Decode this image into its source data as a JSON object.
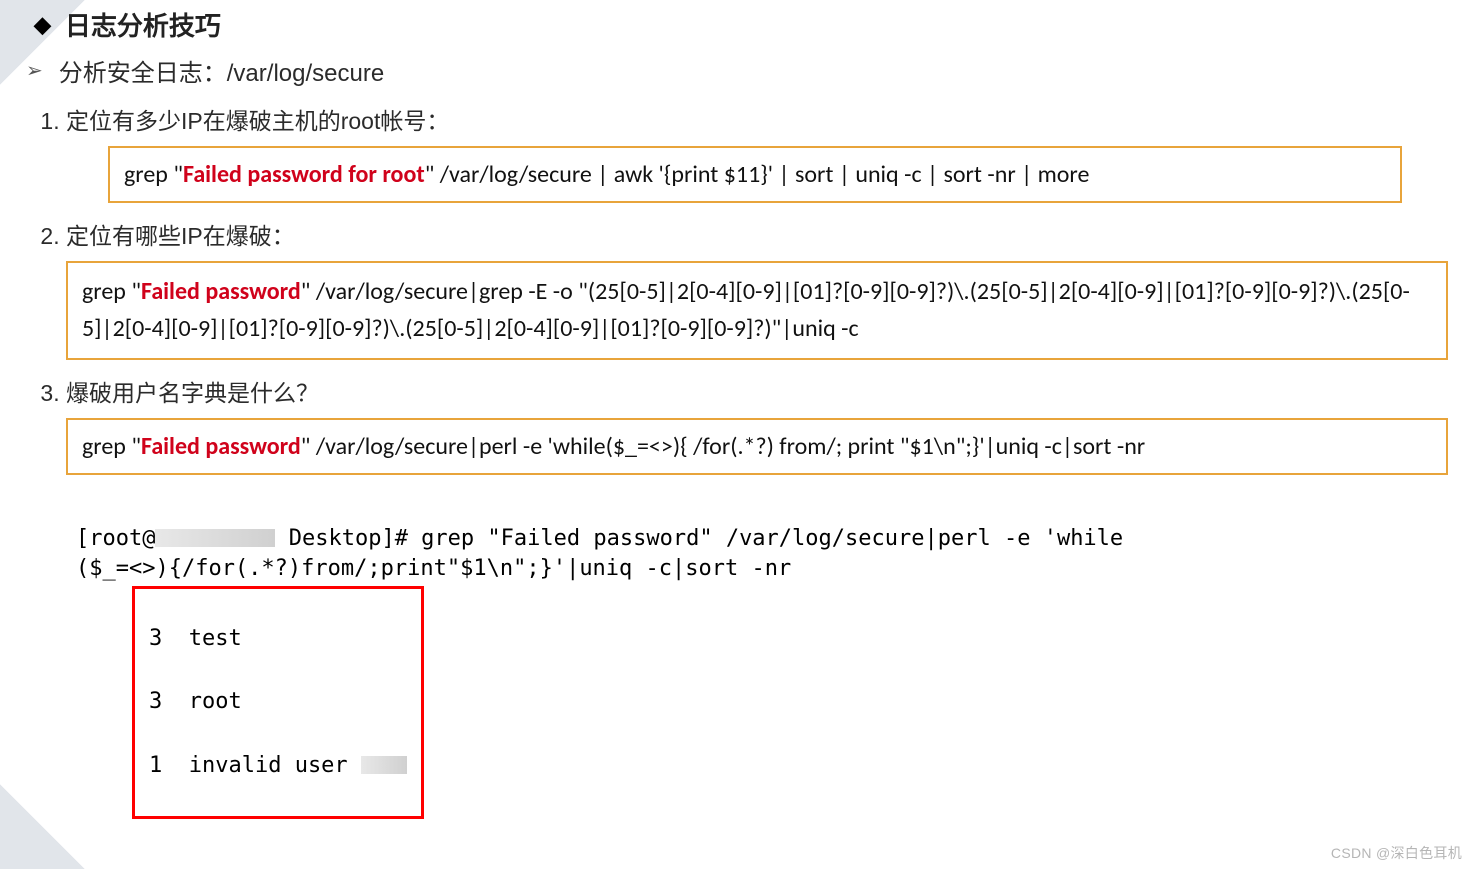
{
  "header": {
    "bullet": "◆",
    "title": "日志分析技巧"
  },
  "sub": {
    "bullet": "➢",
    "text": "分析安全日志：/var/log/secure"
  },
  "steps": [
    {
      "label": "定位有多少IP在爆破主机的root帐号：",
      "cmd_pre": "grep \"",
      "cmd_hot": "Failed password for root",
      "cmd_post": "\" /var/log/secure | awk '{print $11}' | sort | uniq -c | sort -nr | more"
    },
    {
      "label": "定位有哪些IP在爆破：",
      "cmd_pre": "grep \"",
      "cmd_hot": "Failed password",
      "cmd_post": "\" /var/log/secure|grep -E -o \"(25[0-5]|2[0-4][0-9]|[01]?[0-9][0-9]?)\\.(25[0-5]|2[0-4][0-9]|[01]?[0-9][0-9]?)\\.(25[0-5]|2[0-4][0-9]|[01]?[0-9][0-9]?)\\.(25[0-5]|2[0-4][0-9]|[01]?[0-9][0-9]?)\"|uniq -c"
    },
    {
      "label": "爆破用户名字典是什么？",
      "cmd_pre": "grep \"",
      "cmd_hot": "Failed password",
      "cmd_post": "\" /var/log/secure|perl -e 'while($_=<>){ /for(.*?) from/; print \"$1\\n\";}'|uniq -c|sort -nr"
    }
  ],
  "terminal": {
    "line1_a": "[root@",
    "line1_b": " Desktop]# grep \"Failed password\" /var/log/secure|perl -e 'while",
    "line2": "($_=<>){/for(.*?)from/;print\"$1\\n\";}'|uniq -c|sort -nr",
    "results": [
      "3  test",
      "3  root",
      "1  invalid user "
    ]
  },
  "watermark": "CSDN @深白色耳机"
}
